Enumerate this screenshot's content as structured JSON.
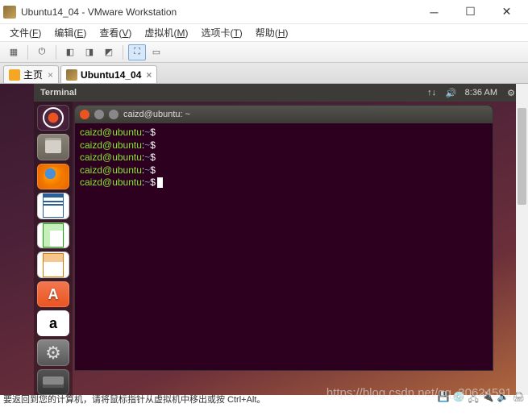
{
  "window": {
    "title": "Ubuntu14_04 - VMware Workstation"
  },
  "menubar": {
    "items": [
      {
        "label": "文件",
        "accel": "F"
      },
      {
        "label": "编辑",
        "accel": "E"
      },
      {
        "label": "查看",
        "accel": "V"
      },
      {
        "label": "虚拟机",
        "accel": "M"
      },
      {
        "label": "选项卡",
        "accel": "T"
      },
      {
        "label": "帮助",
        "accel": "H"
      }
    ]
  },
  "tabs": {
    "home_label": "主页",
    "vm_label": "Ubuntu14_04"
  },
  "ubuntu_panel": {
    "active_app": "Terminal",
    "time": "8:36 AM"
  },
  "terminal": {
    "title": "caizd@ubuntu: ~",
    "prompt_user": "caizd@ubuntu",
    "prompt_path": "~",
    "prompt_symbol": "$",
    "line_count": 5
  },
  "statusbar": {
    "text": "要返回到您的计算机，请将鼠标指针从虚拟机中移出或按 Ctrl+Alt。"
  },
  "watermark": "https://blog.csdn.net/qq_30624591"
}
